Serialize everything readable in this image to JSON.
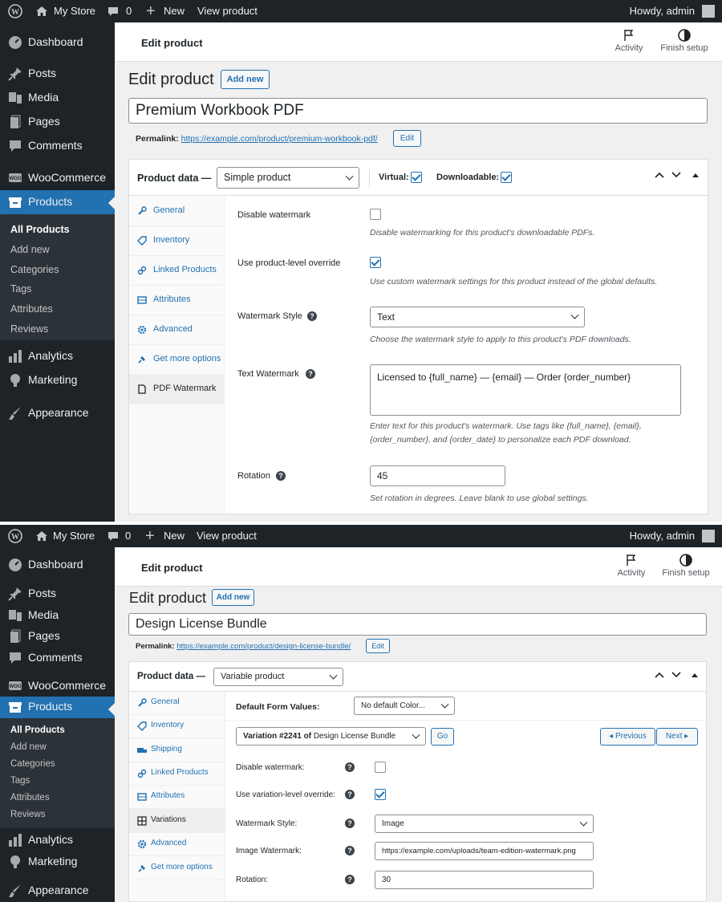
{
  "admin_bar": {
    "site_name": "My Store",
    "comments_count": "0",
    "new_label": "New",
    "view_product": "View product",
    "howdy": "Howdy, admin"
  },
  "sidebar": {
    "items": {
      "dashboard": "Dashboard",
      "posts": "Posts",
      "media": "Media",
      "pages": "Pages",
      "comments": "Comments",
      "woocommerce": "WooCommerce",
      "products": "Products",
      "analytics": "Analytics",
      "marketing": "Marketing",
      "appearance": "Appearance"
    },
    "submenu": {
      "all_products": "All Products",
      "add_new": "Add new",
      "categories": "Categories",
      "tags": "Tags",
      "attributes": "Attributes",
      "reviews": "Reviews"
    }
  },
  "header": {
    "title": "Edit product",
    "activity": "Activity",
    "finish_setup": "Finish setup"
  },
  "page": {
    "heading": "Edit product",
    "add_new": "Add new",
    "permalink_label": "Permalink:",
    "edit_button": "Edit"
  },
  "product_data": {
    "label": "Product data —",
    "virtual_label": "Virtual:",
    "downloadable_label": "Downloadable:"
  },
  "tabs": {
    "general": "General",
    "inventory": "Inventory",
    "shipping": "Shipping",
    "linked_products": "Linked Products",
    "attributes": "Attributes",
    "variations": "Variations",
    "advanced": "Advanced",
    "get_more_options": "Get more options",
    "pdf_watermark": "PDF Watermark"
  },
  "product1": {
    "title": "Premium Workbook PDF",
    "permalink": "https://example.com/product/premium-workbook-pdf/",
    "type": "Simple product",
    "virtual": true,
    "downloadable": true,
    "fields": {
      "disable_label": "Disable watermark",
      "disable_desc": "Disable watermarking for this product's downloadable PDFs.",
      "disable_checked": false,
      "override_label": "Use product-level override",
      "override_desc": "Use custom watermark settings for this product instead of the global defaults.",
      "override_checked": true,
      "style_label": "Watermark Style",
      "style_value": "Text",
      "style_desc": "Choose the watermark style to apply to this product's PDF downloads.",
      "text_label": "Text Watermark",
      "text_value": "Licensed to {full_name} — {email} — Order {order_number}",
      "text_desc_1": "Enter text for this product's watermark. Use tags like {full_name}, {email},",
      "text_desc_2": "{order_number}, and {order_date} to personalize each PDF download.",
      "rotation_label": "Rotation",
      "rotation_value": "45",
      "rotation_desc": "Set rotation in degrees. Leave blank to use global settings."
    }
  },
  "product2": {
    "title": "Design License Bundle",
    "permalink": "https://example.com/product/design-license-bundle/",
    "type": "Variable product",
    "default_form_label": "Default Form Values:",
    "default_form_value": "No default Color...",
    "variation_prefix": "Variation #2241 of",
    "variation_name": "Design License Bundle",
    "go_label": "Go",
    "previous_label": "Previous",
    "next_label": "Next",
    "fields": {
      "disable_label": "Disable watermark:",
      "disable_checked": false,
      "override_label": "Use variation-level override:",
      "override_checked": true,
      "style_label": "Watermark Style:",
      "style_value": "Image",
      "image_label": "Image Watermark:",
      "image_value": "https://example.com/uploads/team-edition-watermark.png",
      "rotation_label": "Rotation:",
      "rotation_value": "30"
    }
  }
}
